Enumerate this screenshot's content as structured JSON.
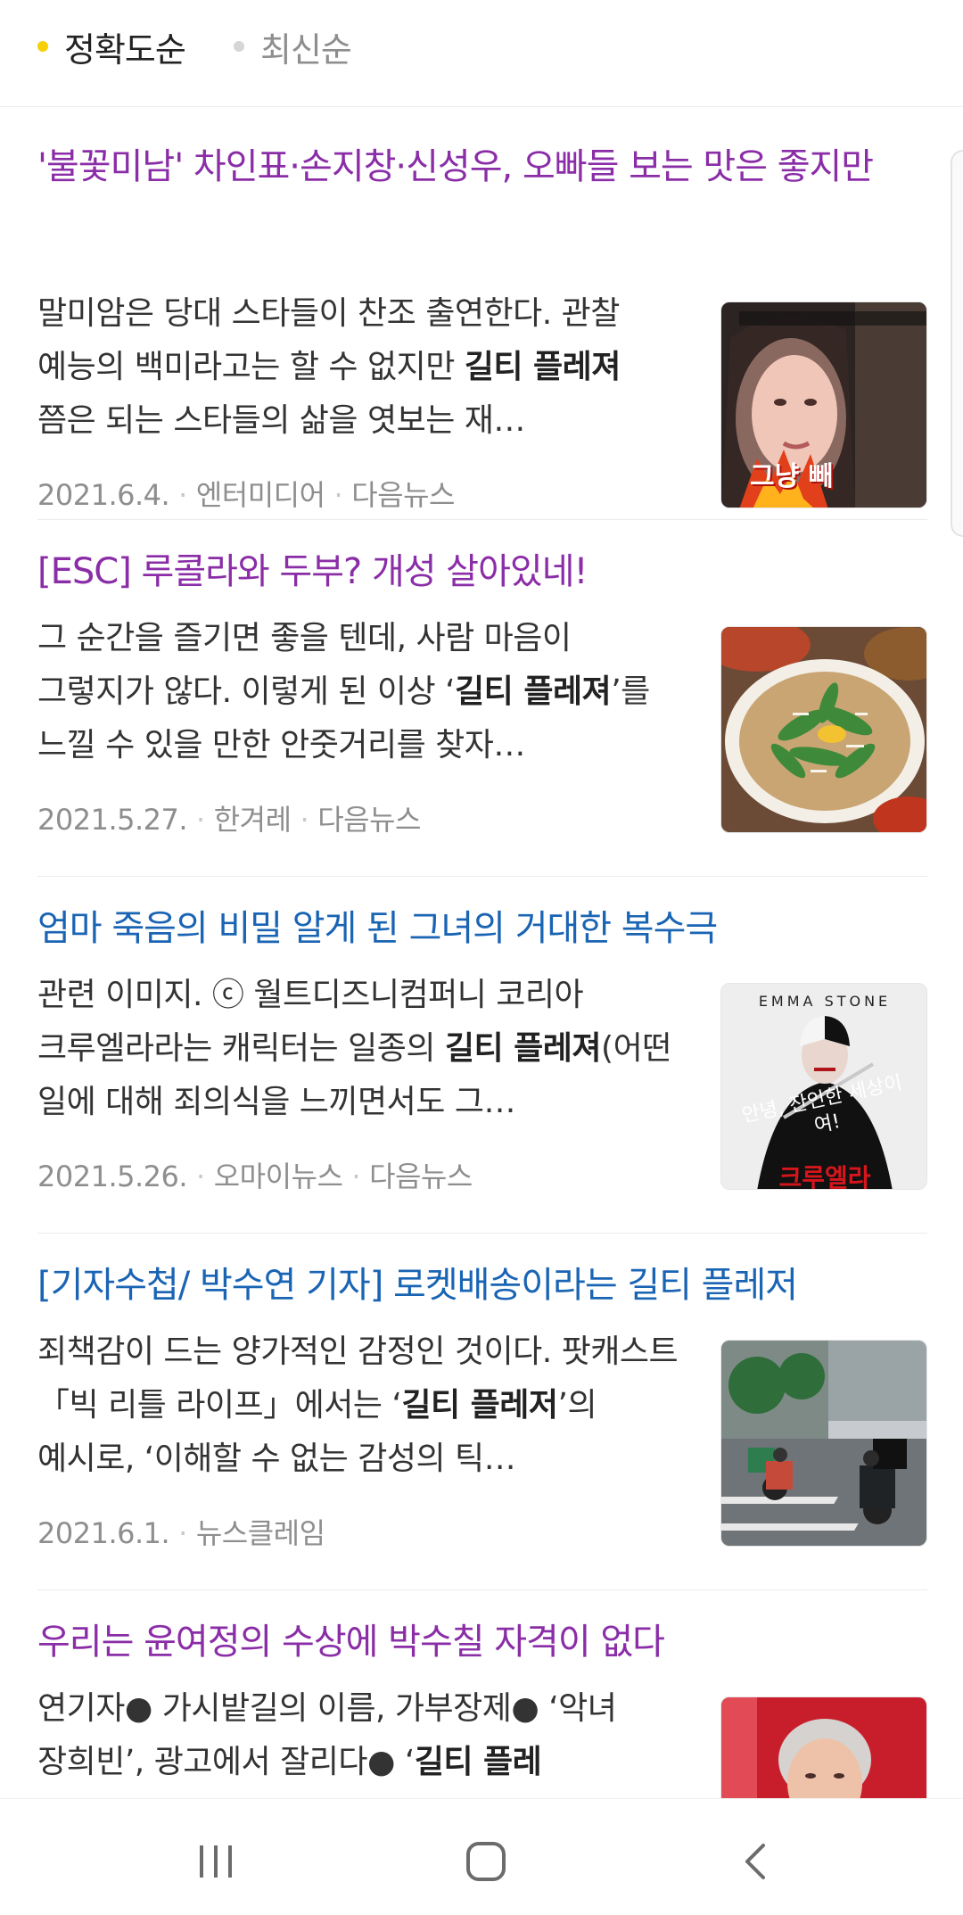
{
  "sort": {
    "options": [
      {
        "label": "정확도순",
        "active": true
      },
      {
        "label": "최신순",
        "active": false
      }
    ]
  },
  "articles": [
    {
      "title": "'불꽃미남' 차인표·손지창·신성우, 오빠들 보는 맛은 좋지만",
      "title_state": "visited",
      "desc_parts": [
        {
          "text": "말미암은 당대 스타들이 찬조 출연한다. 관찰 예능의 백미라고는 할 수 없지만 "
        },
        {
          "text": "길티 플레져",
          "bold": true
        },
        {
          "text": " 쯤은 되는 스타들의 삶을 엿보는 재…"
        }
      ],
      "date": "2021.6.4.",
      "source": "엔터미디어",
      "portal": "다음뉴스",
      "thumb_icon": "person-video-thumbnail",
      "thumb_caption": "그냥 빼"
    },
    {
      "title": "[ESC] 루콜라와 두부? 개성 살아있네!",
      "title_state": "visited",
      "desc_parts": [
        {
          "text": "그 순간을 즐기면 좋을 텐데, 사람 마음이 그렇지가 않다. 이렇게 된 이상 ‘"
        },
        {
          "text": "길티 플레져",
          "bold": true
        },
        {
          "text": "’를 느낄 수 있을 만한 안줏거리를 찾자…"
        }
      ],
      "date": "2021.5.27.",
      "source": "한겨레",
      "portal": "다음뉴스",
      "thumb_icon": "food-salad-thumbnail"
    },
    {
      "title": "엄마 죽음의 비밀 알게 된 그녀의 거대한 복수극",
      "title_state": "unvisited",
      "desc_parts": [
        {
          "text": "관련 이미지. ⓒ 월트디즈니컴퍼니 코리아 크루엘라라는 캐릭터는 일종의 "
        },
        {
          "text": "길티 플레져",
          "bold": true
        },
        {
          "text": "(어떤 일에 대해 죄의식을 느끼면서도 그…"
        }
      ],
      "date": "2021.5.26.",
      "source": "오마이뉴스",
      "portal": "다음뉴스",
      "thumb_icon": "movie-poster-thumbnail",
      "thumb_poster_top": "EMMA STONE",
      "thumb_poster_mid": "안녕, 잔인한 세상이여!",
      "thumb_poster_bottom": "크루엘라"
    },
    {
      "title": "[기자수첩/ 박수연 기자] 로켓배송이라는 길티 플레저",
      "title_state": "unvisited",
      "desc_parts": [
        {
          "text": "죄책감이 드는 양가적인 감정인 것이다. 팟캐스트 「빅 리틀 라이프」에서는 ‘"
        },
        {
          "text": "길티 플레저",
          "bold": true
        },
        {
          "text": "’의 예시로, ‘이해할 수 없는 감성의 틱…"
        }
      ],
      "date": "2021.6.1.",
      "source": "뉴스클레임",
      "portal": "",
      "thumb_icon": "street-scooter-thumbnail"
    },
    {
      "title": "우리는 윤여정의 수상에 박수칠 자격이 없다",
      "title_state": "visited",
      "desc_parts": [
        {
          "text": "연기자● 가시밭길의 이름, 가부장제● ‘악녀 장희빈’, 광고에서 잘리다● ‘"
        },
        {
          "text": "길티 플레",
          "bold": true
        }
      ],
      "date": "",
      "source": "",
      "portal": "",
      "thumb_icon": "actress-portrait-thumbnail"
    }
  ],
  "navbar": {
    "recents": "recent-apps-icon",
    "home": "home-icon",
    "back": "back-icon"
  }
}
